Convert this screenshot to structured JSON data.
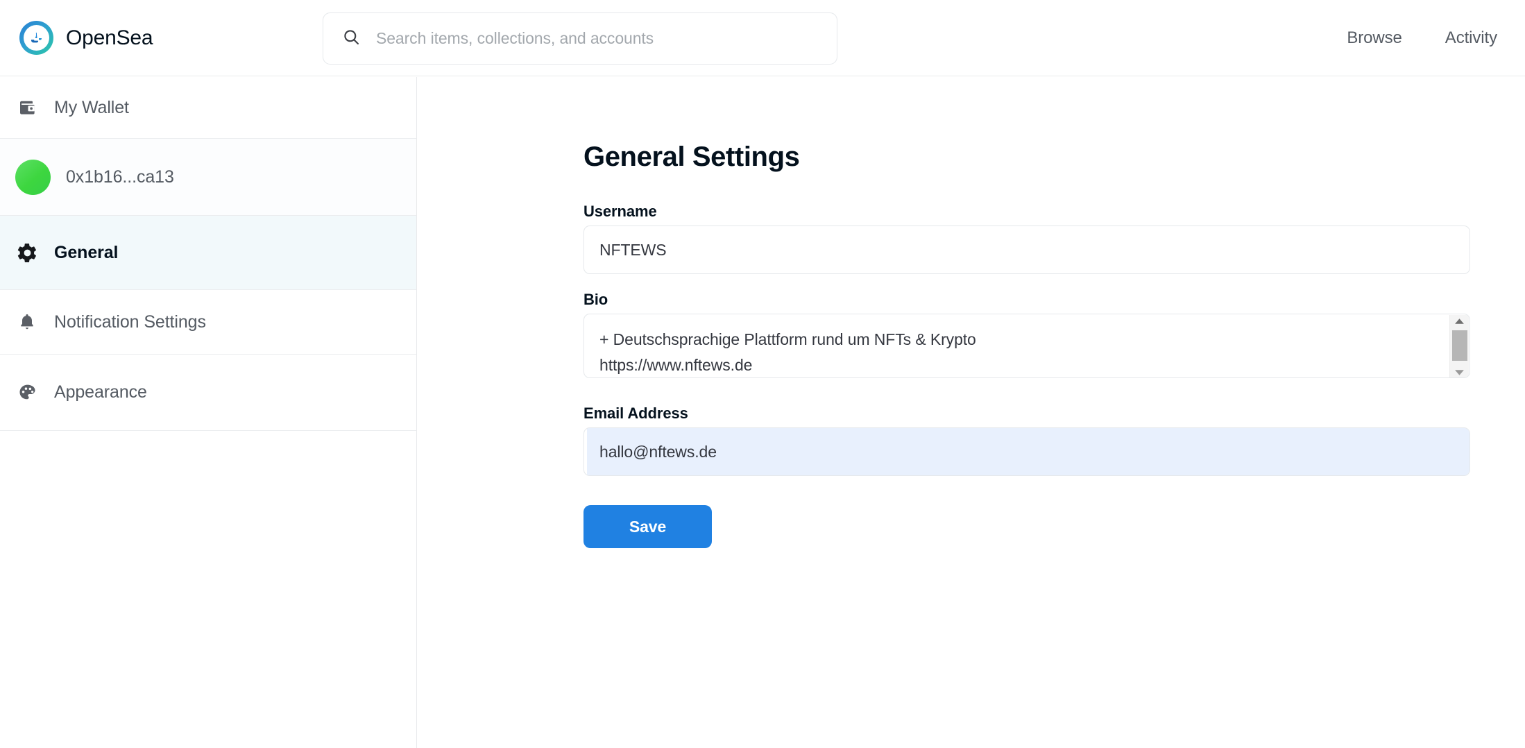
{
  "header": {
    "brand_name": "OpenSea",
    "logo_icon": "opensea-sailboat-logo",
    "search": {
      "icon": "search-icon",
      "placeholder": "Search items, collections, and accounts",
      "value": ""
    },
    "nav": [
      {
        "label": "Browse",
        "name": "browse"
      },
      {
        "label": "Activity",
        "name": "activity"
      }
    ]
  },
  "sidebar": {
    "items": [
      {
        "label": "My Wallet",
        "icon": "wallet-icon",
        "active": false
      },
      {
        "label": "0x1b16...ca13",
        "icon": "avatar-icon",
        "active": false
      },
      {
        "label": "General",
        "icon": "gear-icon",
        "active": true
      },
      {
        "label": "Notification Settings",
        "icon": "bell-icon",
        "active": false
      },
      {
        "label": "Appearance",
        "icon": "palette-icon",
        "active": false
      }
    ]
  },
  "main": {
    "title": "General Settings",
    "fields": {
      "username": {
        "label": "Username",
        "value": "NFTEWS"
      },
      "bio": {
        "label": "Bio",
        "value": "+ Deutschsprachige Plattform rund um NFTs & Krypto\nhttps://www.nftews.de",
        "scrollbar": {
          "up_arrow": "caret-up-icon",
          "down_arrow": "caret-down-icon"
        }
      },
      "email": {
        "label": "Email Address",
        "value": "hallo@nftews.de",
        "autofilled": true
      }
    },
    "save_button": "Save"
  },
  "colors": {
    "accent_blue": "#2081e2",
    "active_row_bg": "#f2f9fb",
    "autofill_bg": "#e8f0fd",
    "avatar_green": "#3dd63f",
    "text_primary": "#04111d",
    "text_secondary": "#545a62"
  }
}
